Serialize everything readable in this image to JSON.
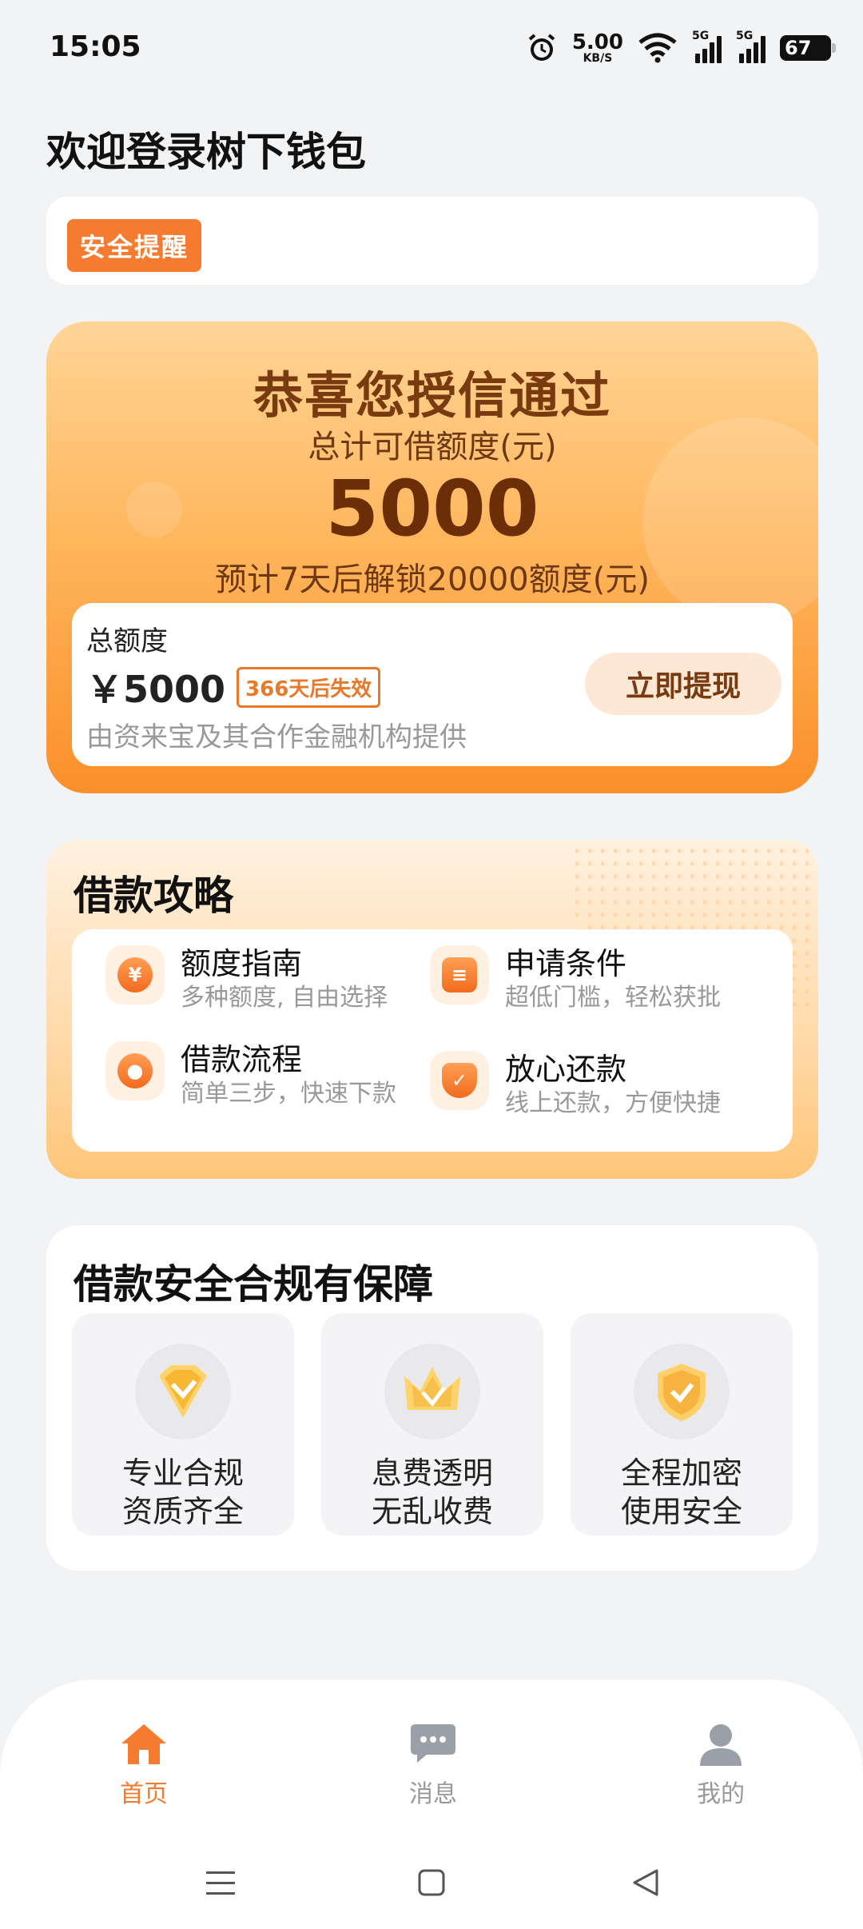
{
  "status_bar": {
    "time": "15:05",
    "net_speed_value": "5.00",
    "net_speed_unit": "KB/S",
    "signal1_label": "5G",
    "signal2_label": "5G",
    "battery": "67",
    "icons": [
      "alarm-icon",
      "wifi-icon",
      "signal-icon",
      "battery-icon"
    ]
  },
  "header": {
    "welcome": "欢迎登录树下钱包"
  },
  "security": {
    "tag": "安全提醒"
  },
  "credit": {
    "congrats": "恭喜您授信通过",
    "total_label": "总计可借额度(元)",
    "amount": "5000",
    "unlock_note": "预计7天后解锁20000额度(元)",
    "quota_title": "总额度",
    "quota_amount": "￥5000",
    "expire": "366天后失效",
    "provider": "由资来宝及其合作金融机构提供",
    "withdraw_button": "立即提现"
  },
  "guide": {
    "title": "借款攻略",
    "items": [
      {
        "title": "额度指南",
        "subtitle": "多种额度, 自由选择",
        "icon": "money-bag-icon"
      },
      {
        "title": "申请条件",
        "subtitle": "超低门槛，轻松获批",
        "icon": "document-icon"
      },
      {
        "title": "借款流程",
        "subtitle": "简单三步，快速下款",
        "icon": "person-icon"
      },
      {
        "title": "放心还款",
        "subtitle": "线上还款，方便快捷",
        "icon": "shield-check-icon"
      }
    ]
  },
  "safety": {
    "title": "借款安全合规有保障",
    "items": [
      {
        "line1": "专业合规",
        "line2": "资质齐全",
        "icon": "diamond-badge-icon"
      },
      {
        "line1": "息费透明",
        "line2": "无乱收费",
        "icon": "crown-icon"
      },
      {
        "line1": "全程加密",
        "line2": "使用安全",
        "icon": "shield-icon"
      }
    ]
  },
  "tabs": [
    {
      "label": "首页",
      "icon": "home-icon",
      "active": true
    },
    {
      "label": "消息",
      "icon": "message-icon",
      "active": false
    },
    {
      "label": "我的",
      "icon": "user-icon",
      "active": false
    }
  ],
  "colors": {
    "accent": "#f47b2f",
    "card_gradient_top": "#ffd597",
    "card_gradient_bottom": "#fb8f2a",
    "title_brown": "#7a3a10"
  }
}
